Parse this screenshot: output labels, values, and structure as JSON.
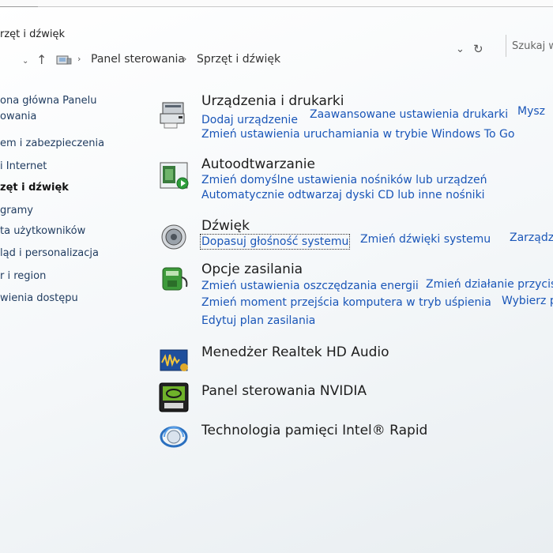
{
  "window": {
    "title": "rzęt i dźwięk"
  },
  "address_bar": {
    "crumbs": [
      "Panel sterowania",
      "Sprzęt i dźwięk"
    ],
    "search_placeholder": "Szukaj w"
  },
  "sidebar": {
    "items": [
      {
        "label": "ona główna Panelu"
      },
      {
        "label": "owania"
      },
      {
        "label": "em i zabezpieczenia"
      },
      {
        "label": "i Internet"
      },
      {
        "label": "zęt i dźwięk"
      },
      {
        "label": "gramy"
      },
      {
        "label": "ta użytkowników"
      },
      {
        "label": "ląd i personalizacja"
      },
      {
        "label": "r i region"
      },
      {
        "label": "wienia dostępu"
      }
    ]
  },
  "categories": [
    {
      "title": "Urządzenia i drukarki",
      "icon": "devices-printers-icon",
      "links": [
        "Dodaj urządzenie",
        "Zaawansowane ustawienia drukarki",
        "Mysz",
        "Zmień ustawienia uruchamiania w trybie Windows To Go"
      ]
    },
    {
      "title": "Autoodtwarzanie",
      "icon": "autoplay-icon",
      "links": [
        "Zmień domyślne ustawienia nośników lub urządzeń",
        "Automatycznie odtwarzaj dyski CD lub inne nośniki"
      ]
    },
    {
      "title": "Dźwięk",
      "icon": "speaker-icon",
      "links": [
        "Dopasuj głośność systemu",
        "Zmień dźwięki systemu",
        "Zarządza"
      ]
    },
    {
      "title": "Opcje zasilania",
      "icon": "power-options-icon",
      "links": [
        "Zmień ustawienia oszczędzania energii",
        "Zmień działanie przycis",
        "Zmień moment przejścia komputera w tryb uśpienia",
        "Wybierz p",
        "Edytuj plan zasilania"
      ]
    },
    {
      "title": "Menedżer Realtek HD Audio",
      "icon": "realtek-audio-icon",
      "links": []
    },
    {
      "title": "Panel sterowania NVIDIA",
      "icon": "nvidia-icon",
      "links": []
    },
    {
      "title": "Technologia pamięci Intel® Rapid",
      "icon": "intel-rapid-storage-icon",
      "links": []
    }
  ],
  "colors": {
    "link": "#1a56b8",
    "background": "#f3f6f7"
  }
}
